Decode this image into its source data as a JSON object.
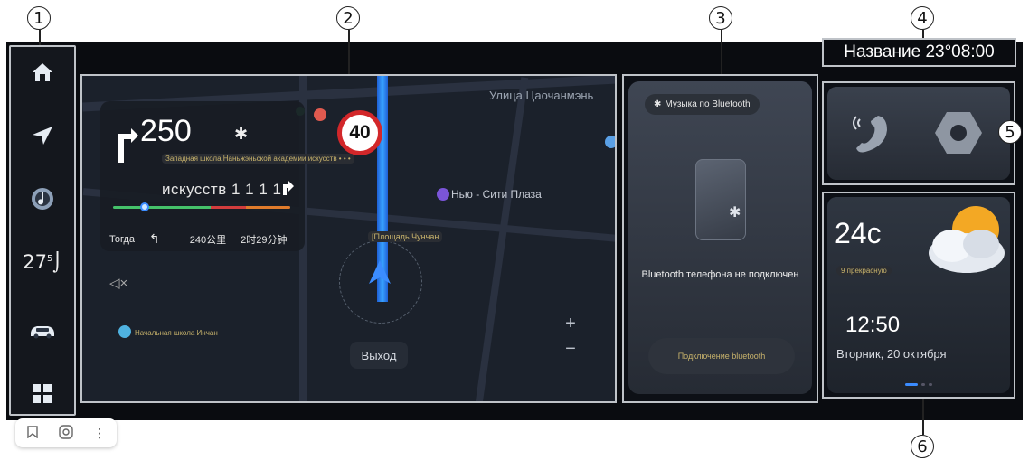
{
  "callouts": [
    "1",
    "2",
    "3",
    "4",
    "5",
    "6"
  ],
  "sidebar": {
    "items": [
      {
        "icon": "home-icon"
      },
      {
        "icon": "navigation-icon"
      },
      {
        "icon": "music-icon"
      },
      {
        "icon": "climate-icon",
        "label": "27",
        "sup": "5"
      },
      {
        "icon": "car-icon"
      },
      {
        "icon": "apps-grid-icon"
      }
    ]
  },
  "map": {
    "street_name": "Улица Цаочанмэнь",
    "speed_limit": "40",
    "poi_1": "Нью - Сити Плаза",
    "location_chip": "[Площадь Чунчан",
    "bottom_left_chip": "Начальная школа Инчан",
    "exit_label": "Выход",
    "zoom_in": "+",
    "zoom_out": "−",
    "nav_card": {
      "distance": "250",
      "next_road": "Западная школа Наньжэньской академии искусств • • •",
      "lane_text": "искусств 1 1 1 1",
      "then_label": "Тогда",
      "remaining_distance": "240公里",
      "remaining_time": "2时29分钟"
    }
  },
  "bluetooth": {
    "chip_label": "Музыка по Bluetooth",
    "status": "Bluetooth телефона не подключен",
    "connect_label": "Подключение bluetooth"
  },
  "titlebar": {
    "text": "Название 23°08:00"
  },
  "shortcuts": [
    {
      "icon": "phone-icon"
    },
    {
      "icon": "settings-icon"
    }
  ],
  "weather": {
    "temp": "24c",
    "condition": "9 прекрасную",
    "time": "12:50",
    "date": "Вторник, 20 октября"
  },
  "colors": {
    "route_blue": "#38a4ff",
    "accent_gold": "#c9b46c",
    "speed_red": "#d2272a",
    "frame_gray": "#bfc3c8"
  }
}
